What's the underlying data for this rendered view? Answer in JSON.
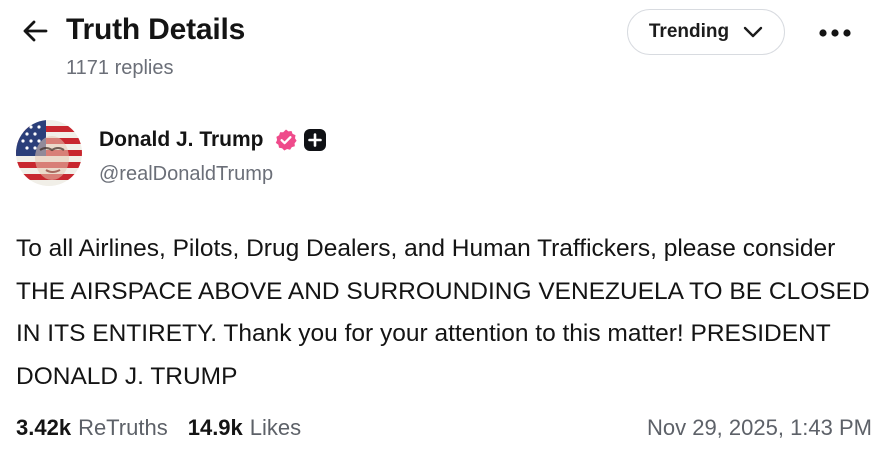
{
  "header": {
    "title": "Truth Details",
    "reply_count": "1171 replies",
    "sort_label": "Trending",
    "back_icon": "arrow-left-icon",
    "more_icon": "more-horizontal-icon"
  },
  "post": {
    "author_name": "Donald J. Trump",
    "handle": "@realDonaldTrump",
    "verified_color": "#ef4b8b",
    "body": "To all Airlines, Pilots, Drug Dealers, and Human Traffickers, please consider THE AIRSPACE ABOVE AND SURROUNDING VENEZUELA TO BE CLOSED IN ITS ENTIRETY. Thank you for your attention to this matter! PRESIDENT DONALD J. TRUMP",
    "retruths_count": "3.42k",
    "retruths_label": "ReTruths",
    "likes_count": "14.9k",
    "likes_label": "Likes",
    "timestamp": "Nov 29, 2025, 1:43 PM"
  }
}
